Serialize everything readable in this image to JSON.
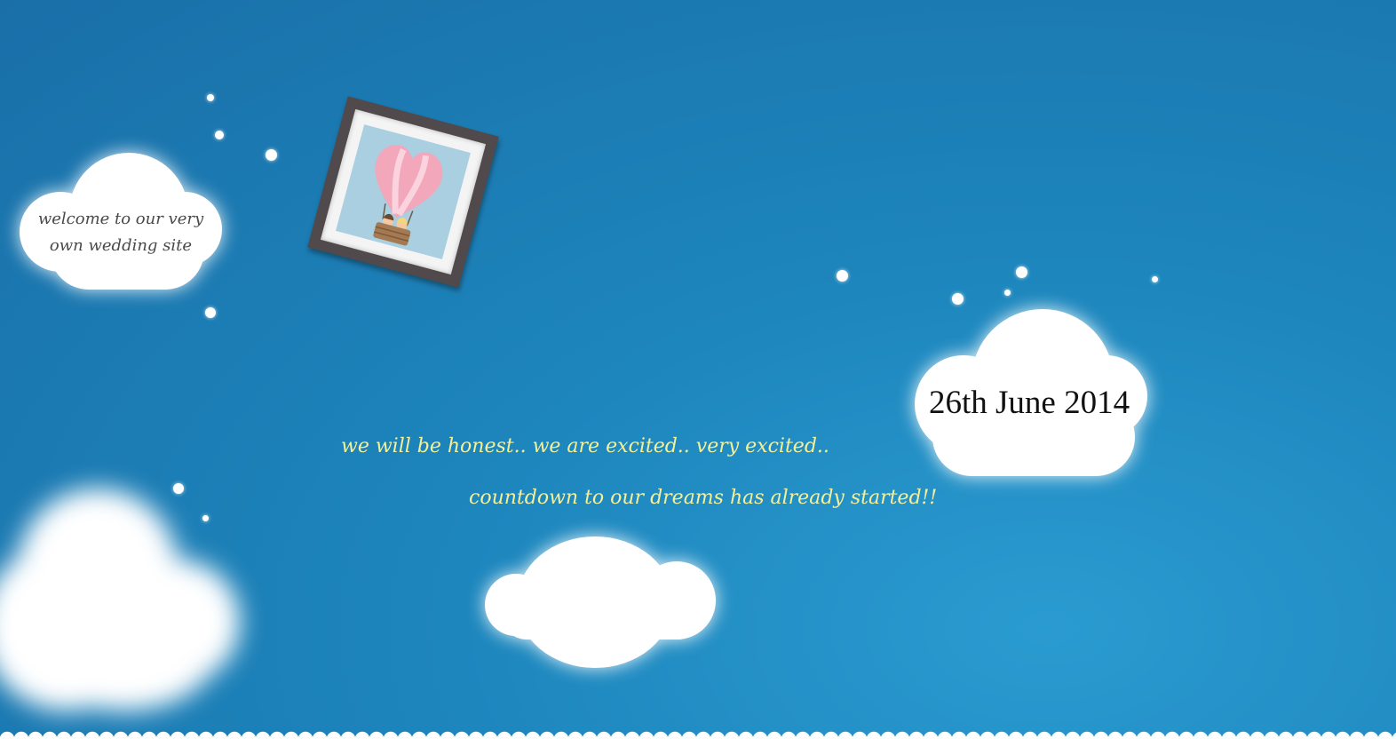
{
  "welcome_cloud": {
    "line1": "welcome to our very",
    "line2": "own wedding site"
  },
  "date_cloud": {
    "date": "26th June 2014"
  },
  "tagline": {
    "line1": "we will be honest.. we are excited.. very excited..",
    "line2": "countdown to our dreams has already started!!"
  },
  "photo_frame": {
    "icon": "hot-air-balloon-couple-icon"
  },
  "colors": {
    "sky": "#1d86bd",
    "tagline_text": "#f3f09a",
    "cloud": "#ffffff",
    "balloon_pink": "#f2a7bb",
    "frame": "#514a4c"
  }
}
